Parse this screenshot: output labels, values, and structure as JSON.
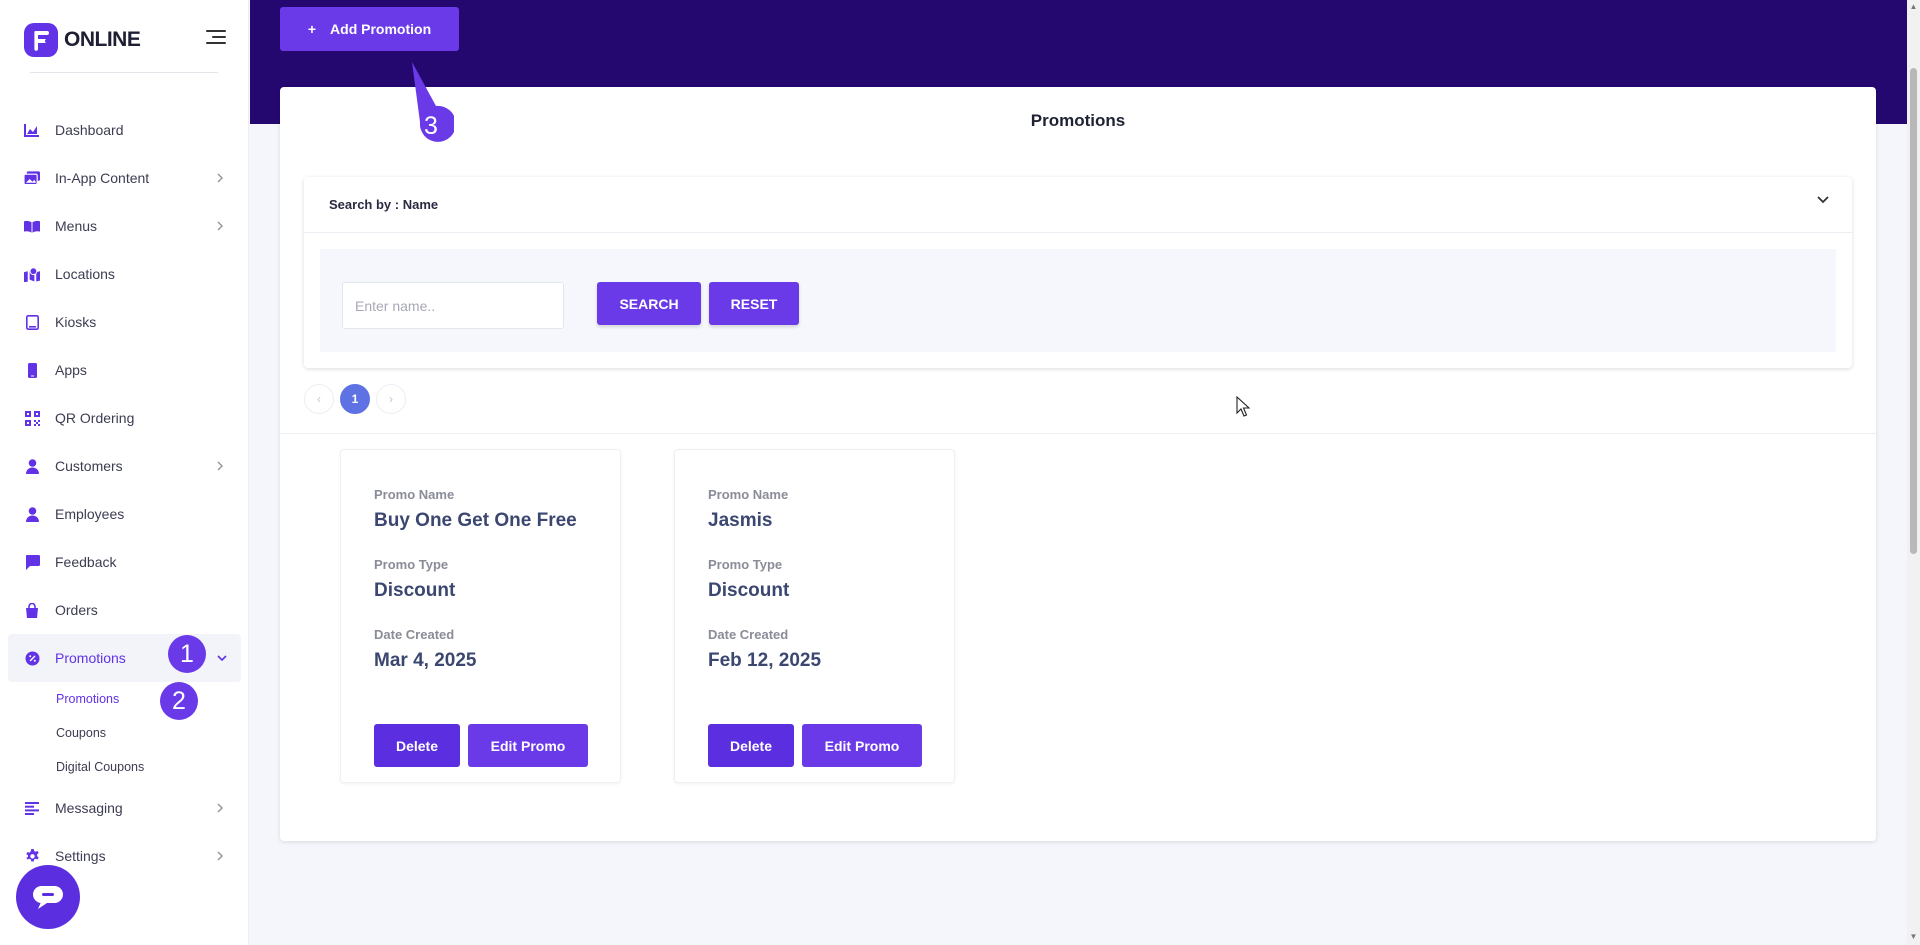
{
  "brand": {
    "name": "ONLINE"
  },
  "sidebar": {
    "items": [
      {
        "label": "Dashboard",
        "icon": "chart-area-icon",
        "chevron": false
      },
      {
        "label": "In-App Content",
        "icon": "images-icon",
        "chevron": true
      },
      {
        "label": "Menus",
        "icon": "book-open-icon",
        "chevron": true
      },
      {
        "label": "Locations",
        "icon": "map-location-icon",
        "chevron": false
      },
      {
        "label": "Kiosks",
        "icon": "tablet-icon",
        "chevron": false
      },
      {
        "label": "Apps",
        "icon": "mobile-icon",
        "chevron": false
      },
      {
        "label": "QR Ordering",
        "icon": "qrcode-icon",
        "chevron": false
      },
      {
        "label": "Customers",
        "icon": "user-icon",
        "chevron": true
      },
      {
        "label": "Employees",
        "icon": "user-icon",
        "chevron": false
      },
      {
        "label": "Feedback",
        "icon": "comment-icon",
        "chevron": false
      },
      {
        "label": "Orders",
        "icon": "shopping-bag-icon",
        "chevron": false
      },
      {
        "label": "Promotions",
        "icon": "badge-percent-icon",
        "chevron": true,
        "active": true
      }
    ],
    "sub_items": [
      {
        "label": "Promotions",
        "active": true
      },
      {
        "label": "Coupons"
      },
      {
        "label": "Digital Coupons"
      }
    ],
    "items_after": [
      {
        "label": "Messaging",
        "icon": "align-left-icon",
        "chevron": true
      },
      {
        "label": "Settings",
        "icon": "gear-icon",
        "chevron": true
      }
    ]
  },
  "steps": {
    "one": "1",
    "two": "2",
    "three": "3"
  },
  "header": {
    "add_label": "Add Promotion",
    "add_icon": "plus-icon"
  },
  "main": {
    "title": "Promotions",
    "search": {
      "by_label": "Search by : Name",
      "placeholder": "Enter name..",
      "search_label": "SEARCH",
      "reset_label": "RESET"
    },
    "pagination": {
      "prev": "‹",
      "current": "1",
      "next": "›"
    },
    "promos": [
      {
        "name_label": "Promo Name",
        "name": "Buy One Get One Free",
        "type_label": "Promo Type",
        "type": "Discount",
        "date_label": "Date Created",
        "date": "Mar 4, 2025",
        "delete_label": "Delete",
        "edit_label": "Edit Promo"
      },
      {
        "name_label": "Promo Name",
        "name": "Jasmis",
        "type_label": "Promo Type",
        "type": "Discount",
        "date_label": "Date Created",
        "date": "Feb 12, 2025",
        "delete_label": "Delete",
        "edit_label": "Edit Promo"
      }
    ]
  },
  "colors": {
    "accent": "#6a3ae8",
    "header": "#240870",
    "page_bg": "#f5f6fb"
  }
}
